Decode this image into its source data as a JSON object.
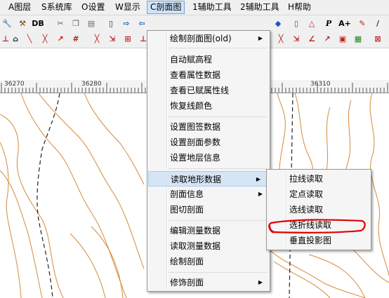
{
  "menubar": {
    "items": [
      {
        "label": "A图层"
      },
      {
        "label": "S系统库"
      },
      {
        "label": "O设置"
      },
      {
        "label": "W显示"
      },
      {
        "label": "C剖面图"
      },
      {
        "label": "1辅助工具"
      },
      {
        "label": "2辅助工具"
      },
      {
        "label": "H帮助"
      }
    ]
  },
  "toolbar": {
    "db_label": "DB",
    "aplus_label": "A+",
    "p_label": "P"
  },
  "ruler": {
    "labels": [
      "36270",
      "36280",
      "36310"
    ]
  },
  "section_menu": {
    "items": [
      {
        "label": "绘制剖面图(old)"
      },
      {
        "label": "自动赋高程"
      },
      {
        "label": "查看属性数据"
      },
      {
        "label": "查看已赋属性线"
      },
      {
        "label": "恢复线颜色"
      },
      {
        "label": "设置图签数据"
      },
      {
        "label": "设置剖面参数"
      },
      {
        "label": "设置地层信息"
      },
      {
        "label": "读取地形数据"
      },
      {
        "label": "剖面信息"
      },
      {
        "label": "图切剖面"
      },
      {
        "label": "编辑测量数据"
      },
      {
        "label": "读取测量数据"
      },
      {
        "label": "绘制剖面"
      },
      {
        "label": "修饰剖面"
      }
    ]
  },
  "terrain_submenu": {
    "items": [
      {
        "label": "拉线读取"
      },
      {
        "label": "定点读取"
      },
      {
        "label": "选线读取"
      },
      {
        "label": "选折线读取"
      },
      {
        "label": "垂直投影图"
      }
    ]
  },
  "colors": {
    "contour": "#d38a3a",
    "annotation": "#e00000",
    "highlight": "#d6e5f6"
  }
}
